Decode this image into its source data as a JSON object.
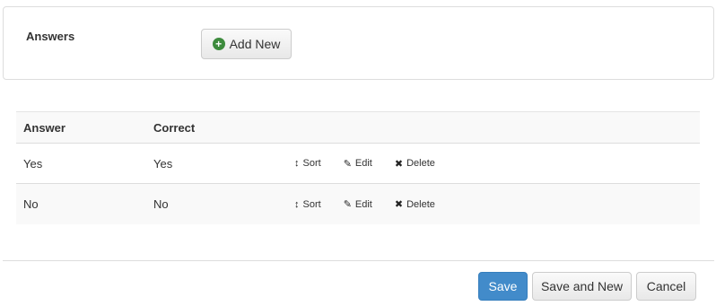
{
  "answers_section": {
    "label": "Answers",
    "add_new_label": "Add New",
    "add_icon": "plus-circle-icon"
  },
  "table": {
    "columns": [
      "Answer",
      "Correct"
    ],
    "rows": [
      {
        "answer": "Yes",
        "correct": "Yes"
      },
      {
        "answer": "No",
        "correct": "No"
      }
    ],
    "actions": {
      "sort": "Sort",
      "edit": "Edit",
      "delete": "Delete"
    }
  },
  "footer": {
    "save_label": "Save",
    "save_and_new_label": "Save and New",
    "cancel_label": "Cancel"
  },
  "colors": {
    "primary": "#428bca",
    "add_icon": "#3d8b3d"
  }
}
